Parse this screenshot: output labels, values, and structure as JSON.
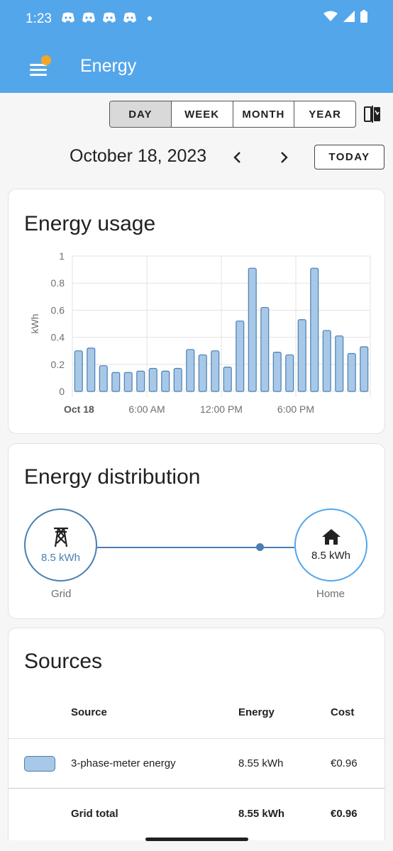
{
  "status_bar": {
    "time": "1:23"
  },
  "header": {
    "title": "Energy"
  },
  "range_selector": {
    "options": [
      "DAY",
      "WEEK",
      "MONTH",
      "YEAR"
    ],
    "active": "DAY"
  },
  "date_nav": {
    "date": "October 18, 2023",
    "today_label": "TODAY"
  },
  "energy_usage": {
    "title": "Energy usage"
  },
  "chart_data": {
    "type": "bar",
    "title": "Energy usage",
    "ylabel": "kWh",
    "ylim": [
      0,
      1
    ],
    "y_ticks": [
      "0",
      "0.2",
      "0.4",
      "0.6",
      "0.8",
      "1"
    ],
    "x_tick_labels": [
      "Oct 18",
      "6:00 AM",
      "12:00 PM",
      "6:00 PM"
    ],
    "categories": [
      "00:00",
      "01:00",
      "02:00",
      "03:00",
      "04:00",
      "05:00",
      "06:00",
      "07:00",
      "08:00",
      "09:00",
      "10:00",
      "11:00",
      "12:00",
      "13:00",
      "14:00",
      "15:00",
      "16:00",
      "17:00",
      "18:00",
      "19:00",
      "20:00",
      "21:00",
      "22:00",
      "23:00"
    ],
    "values": [
      0.3,
      0.32,
      0.19,
      0.14,
      0.14,
      0.15,
      0.17,
      0.15,
      0.17,
      0.31,
      0.27,
      0.3,
      0.18,
      0.52,
      0.91,
      0.62,
      0.29,
      0.27,
      0.53,
      0.91,
      0.45,
      0.41,
      0.28,
      0.33
    ],
    "bar_color": "#a8c8e8",
    "bar_border": "#4a7fb0",
    "grid": true
  },
  "energy_distribution": {
    "title": "Energy distribution",
    "grid": {
      "value": "8.5 kWh",
      "label": "Grid"
    },
    "home": {
      "value": "8.5 kWh",
      "label": "Home"
    }
  },
  "sources": {
    "title": "Sources",
    "columns": [
      "Source",
      "Energy",
      "Cost"
    ],
    "rows": [
      {
        "source": "3-phase-meter energy",
        "energy": "8.55 kWh",
        "cost": "€0.96"
      }
    ],
    "total": {
      "label": "Grid total",
      "energy": "8.55 kWh",
      "cost": "€0.96"
    }
  }
}
